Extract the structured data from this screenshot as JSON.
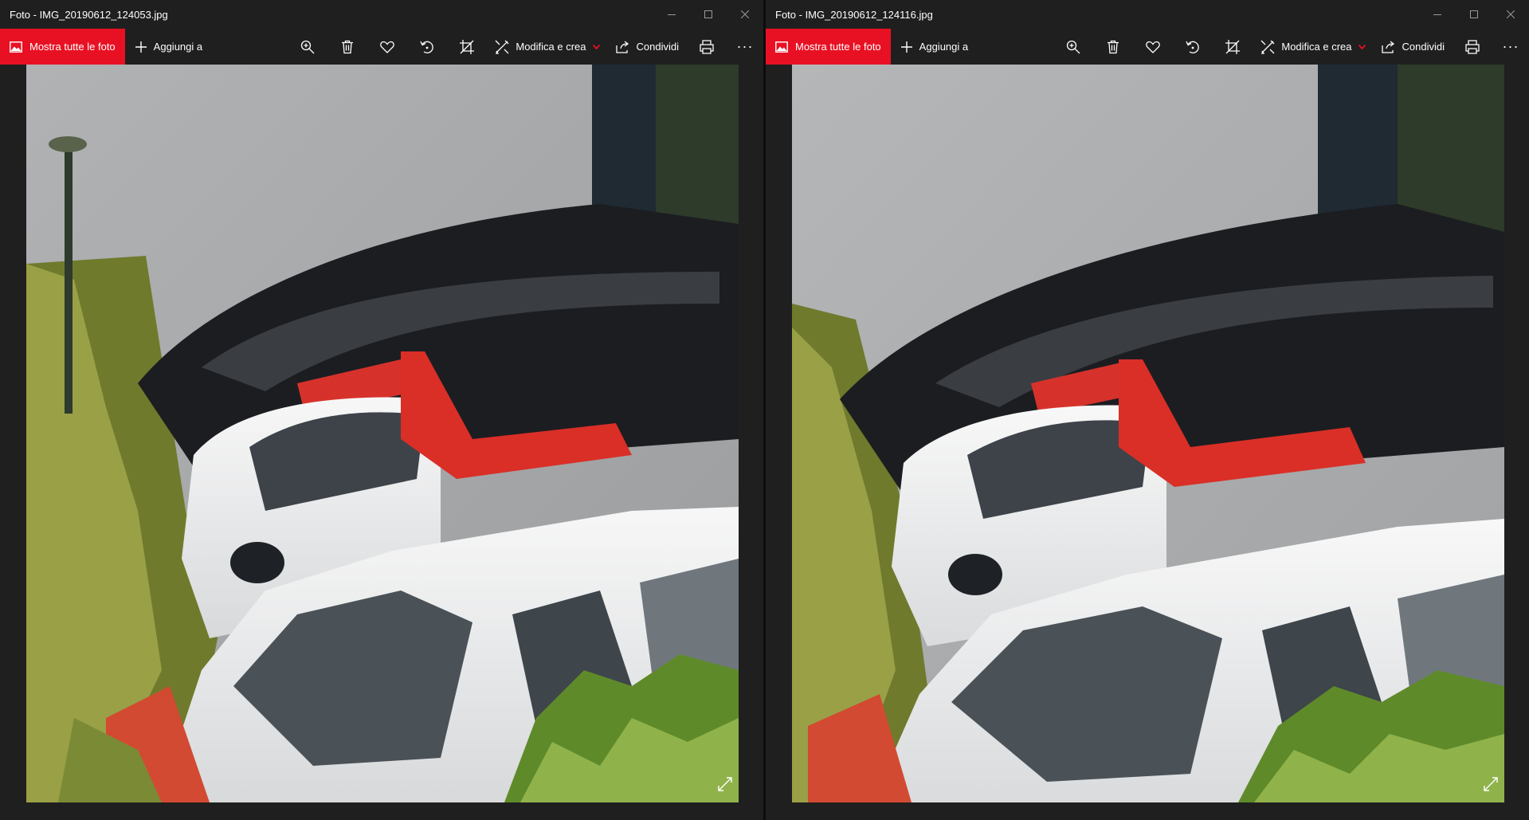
{
  "windows": [
    {
      "title": "Foto - IMG_20190612_124053.jpg",
      "toolbar": {
        "show_all_label": "Mostra tutte le foto",
        "add_label": "Aggiungi a",
        "edit_label": "Modifica e crea",
        "share_label": "Condividi",
        "more_label": "···"
      }
    },
    {
      "title": "Foto - IMG_20190612_124116.jpg",
      "toolbar": {
        "show_all_label": "Mostra tutte le foto",
        "add_label": "Aggiungi a",
        "edit_label": "Modifica e crea",
        "share_label": "Condividi",
        "more_label": "···"
      }
    }
  ],
  "icons": {
    "show_all": "photos-icon",
    "add": "plus-icon",
    "zoom": "zoom-in-icon",
    "delete": "trash-icon",
    "favorite": "heart-icon",
    "rotate": "rotate-icon",
    "crop": "crop-icon",
    "edit": "edit-create-icon",
    "share": "share-icon",
    "print": "print-icon",
    "expand": "expand-icon",
    "minimize": "minimize-icon",
    "maximize": "maximize-icon",
    "close": "close-icon"
  },
  "colors": {
    "accent": "#e81123",
    "chrome": "#1f1f1f",
    "text": "#ffffff"
  }
}
